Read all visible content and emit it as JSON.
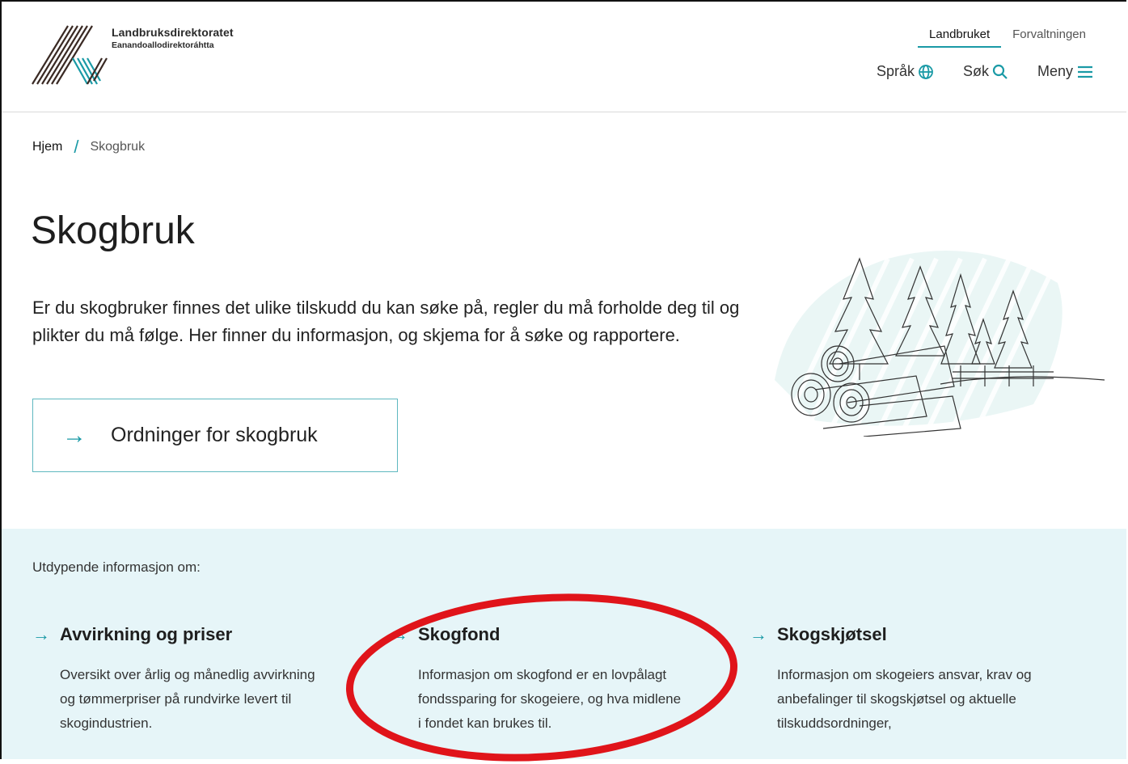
{
  "header": {
    "logo_title": "Landbruksdirektoratet",
    "logo_subtitle": "Eanandoallodirektoráhtta",
    "tabs": [
      {
        "label": "Landbruket",
        "active": true
      },
      {
        "label": "Forvaltningen",
        "active": false
      }
    ],
    "tools": {
      "language": "Språk",
      "search": "Søk",
      "menu": "Meny"
    }
  },
  "breadcrumb": {
    "home": "Hjem",
    "separator": "/",
    "current": "Skogbruk"
  },
  "page": {
    "title": "Skogbruk",
    "intro": "Er du skogbruker finnes det ulike tilskudd du kan søke på, regler du må forholde deg til og plikter du må følge. Her finner du informasjon, og skjema for å søke og rapportere.",
    "cta_label": "Ordninger for skogbruk"
  },
  "more_info": {
    "label": "Utdypende informasjon om:",
    "cards": [
      {
        "title": "Avvirkning og priser",
        "text": "Oversikt over årlig og månedlig avvirkning og tømmerpriser på rundvirke levert til skogindustrien."
      },
      {
        "title": "Skogfond",
        "text": "Informasjon om skogfond er en lovpålagt fondssparing for skogeiere, og hva midlene i fondet kan brukes til."
      },
      {
        "title": "Skogskjøtsel",
        "text": "Informasjon om skogeiers ansvar, krav og anbefalinger til skogskjøtsel og aktuelle tilskuddsordninger,"
      }
    ]
  },
  "colors": {
    "accent": "#1a9aa6",
    "info_background": "#e6f5f8",
    "annotation": "#e0141a"
  },
  "icons": [
    "globe-icon",
    "search-icon",
    "menu-icon",
    "arrow-right-icon"
  ]
}
